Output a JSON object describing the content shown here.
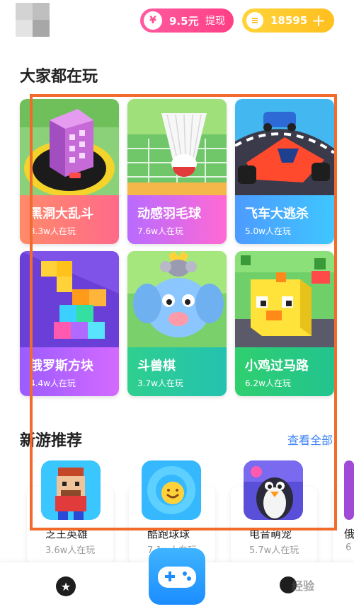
{
  "header": {
    "cash_amount": "9.5元",
    "withdraw_label": "提现",
    "coin_amount": "18595",
    "plus_symbol": "+"
  },
  "popular": {
    "title": "大家都在玩",
    "games": [
      {
        "name": "黑洞大乱斗",
        "players": "3.3w人在玩"
      },
      {
        "name": "动感羽毛球",
        "players": "7.6w人在玩"
      },
      {
        "name": "飞车大逃杀",
        "players": "5.0w人在玩"
      },
      {
        "name": "俄罗斯方块",
        "players": "4.4w人在玩"
      },
      {
        "name": "斗兽棋",
        "players": "3.7w人在玩"
      },
      {
        "name": "小鸡过马路",
        "players": "6.2w人在玩"
      }
    ]
  },
  "new_games": {
    "title": "新游推荐",
    "see_all": "查看全部",
    "games": [
      {
        "name": "乏王英雄",
        "players": "3.6w人在玩"
      },
      {
        "name": "酷跑球球",
        "players": "7.1w人在玩"
      },
      {
        "name": "电音萌宠",
        "players": "5.7w人在玩"
      },
      {
        "name": "俄",
        "players": "6"
      }
    ]
  },
  "watermark": "经验",
  "colors": {
    "cash_pill": "#ff4b8e",
    "coin_pill": "#ffc62a",
    "link": "#3b82f6",
    "highlight_box": "#f26a2c"
  },
  "icons": [
    "cash-icon",
    "coin-icon",
    "plus-icon",
    "star-icon",
    "gamepad-icon",
    "user-icon"
  ]
}
